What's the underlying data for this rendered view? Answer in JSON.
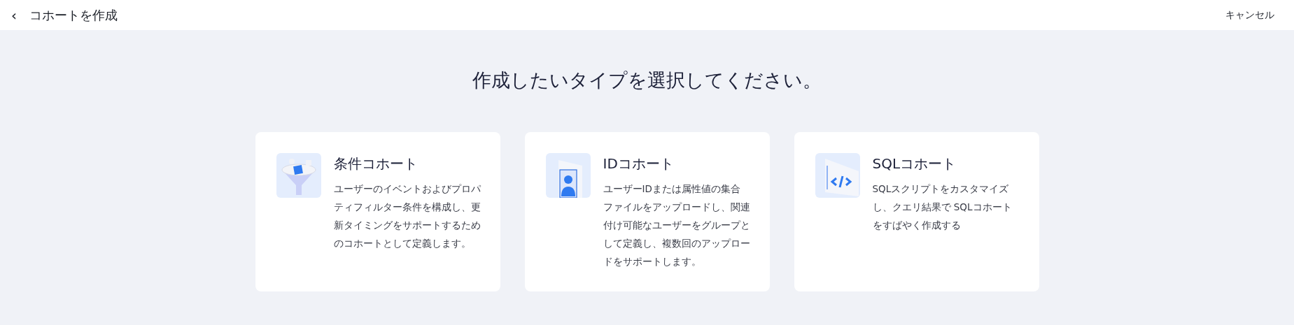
{
  "header": {
    "back_icon": "‹",
    "title": "コホートを作成",
    "cancel": "キャンセル"
  },
  "heading": "作成したいタイプを選択してください。",
  "cards": [
    {
      "kind": "condition",
      "title": "条件コホート",
      "description": "ユーザーのイベントおよびプロパティフィルター条件を構成し、更新タイミングをサポートするためのコホートとして定義します。"
    },
    {
      "kind": "id",
      "title": "IDコホート",
      "description": "ユーザーIDまたは属性値の集合ファイルをアップロードし、関連付け可能なユーザーをグループとして定義し、複数回のアップロードをサポートします。"
    },
    {
      "kind": "sql",
      "title": "SQLコホート",
      "description": "SQLスクリプトをカスタマイズし、クエリ結果で SQLコホートをすばやく作成する"
    }
  ]
}
